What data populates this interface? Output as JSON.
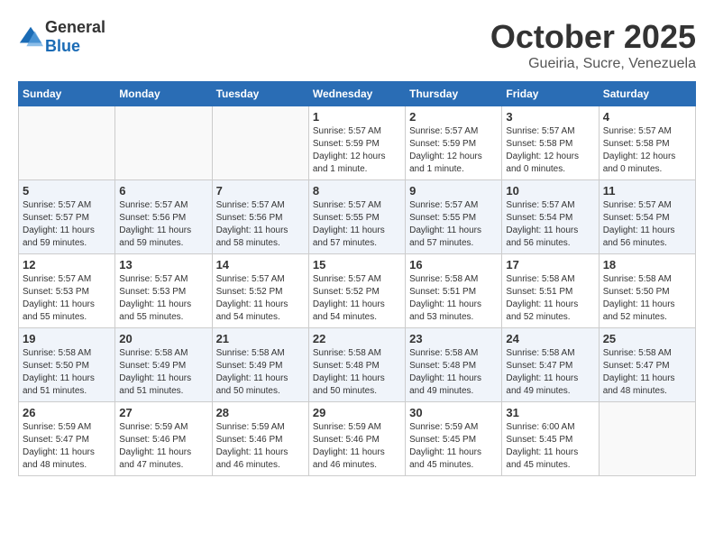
{
  "header": {
    "logo_general": "General",
    "logo_blue": "Blue",
    "month_title": "October 2025",
    "subtitle": "Gueiria, Sucre, Venezuela"
  },
  "days_of_week": [
    "Sunday",
    "Monday",
    "Tuesday",
    "Wednesday",
    "Thursday",
    "Friday",
    "Saturday"
  ],
  "weeks": [
    {
      "shaded": false,
      "days": [
        {
          "number": "",
          "info": ""
        },
        {
          "number": "",
          "info": ""
        },
        {
          "number": "",
          "info": ""
        },
        {
          "number": "1",
          "info": "Sunrise: 5:57 AM\nSunset: 5:59 PM\nDaylight: 12 hours\nand 1 minute."
        },
        {
          "number": "2",
          "info": "Sunrise: 5:57 AM\nSunset: 5:59 PM\nDaylight: 12 hours\nand 1 minute."
        },
        {
          "number": "3",
          "info": "Sunrise: 5:57 AM\nSunset: 5:58 PM\nDaylight: 12 hours\nand 0 minutes."
        },
        {
          "number": "4",
          "info": "Sunrise: 5:57 AM\nSunset: 5:58 PM\nDaylight: 12 hours\nand 0 minutes."
        }
      ]
    },
    {
      "shaded": true,
      "days": [
        {
          "number": "5",
          "info": "Sunrise: 5:57 AM\nSunset: 5:57 PM\nDaylight: 11 hours\nand 59 minutes."
        },
        {
          "number": "6",
          "info": "Sunrise: 5:57 AM\nSunset: 5:56 PM\nDaylight: 11 hours\nand 59 minutes."
        },
        {
          "number": "7",
          "info": "Sunrise: 5:57 AM\nSunset: 5:56 PM\nDaylight: 11 hours\nand 58 minutes."
        },
        {
          "number": "8",
          "info": "Sunrise: 5:57 AM\nSunset: 5:55 PM\nDaylight: 11 hours\nand 57 minutes."
        },
        {
          "number": "9",
          "info": "Sunrise: 5:57 AM\nSunset: 5:55 PM\nDaylight: 11 hours\nand 57 minutes."
        },
        {
          "number": "10",
          "info": "Sunrise: 5:57 AM\nSunset: 5:54 PM\nDaylight: 11 hours\nand 56 minutes."
        },
        {
          "number": "11",
          "info": "Sunrise: 5:57 AM\nSunset: 5:54 PM\nDaylight: 11 hours\nand 56 minutes."
        }
      ]
    },
    {
      "shaded": false,
      "days": [
        {
          "number": "12",
          "info": "Sunrise: 5:57 AM\nSunset: 5:53 PM\nDaylight: 11 hours\nand 55 minutes."
        },
        {
          "number": "13",
          "info": "Sunrise: 5:57 AM\nSunset: 5:53 PM\nDaylight: 11 hours\nand 55 minutes."
        },
        {
          "number": "14",
          "info": "Sunrise: 5:57 AM\nSunset: 5:52 PM\nDaylight: 11 hours\nand 54 minutes."
        },
        {
          "number": "15",
          "info": "Sunrise: 5:57 AM\nSunset: 5:52 PM\nDaylight: 11 hours\nand 54 minutes."
        },
        {
          "number": "16",
          "info": "Sunrise: 5:58 AM\nSunset: 5:51 PM\nDaylight: 11 hours\nand 53 minutes."
        },
        {
          "number": "17",
          "info": "Sunrise: 5:58 AM\nSunset: 5:51 PM\nDaylight: 11 hours\nand 52 minutes."
        },
        {
          "number": "18",
          "info": "Sunrise: 5:58 AM\nSunset: 5:50 PM\nDaylight: 11 hours\nand 52 minutes."
        }
      ]
    },
    {
      "shaded": true,
      "days": [
        {
          "number": "19",
          "info": "Sunrise: 5:58 AM\nSunset: 5:50 PM\nDaylight: 11 hours\nand 51 minutes."
        },
        {
          "number": "20",
          "info": "Sunrise: 5:58 AM\nSunset: 5:49 PM\nDaylight: 11 hours\nand 51 minutes."
        },
        {
          "number": "21",
          "info": "Sunrise: 5:58 AM\nSunset: 5:49 PM\nDaylight: 11 hours\nand 50 minutes."
        },
        {
          "number": "22",
          "info": "Sunrise: 5:58 AM\nSunset: 5:48 PM\nDaylight: 11 hours\nand 50 minutes."
        },
        {
          "number": "23",
          "info": "Sunrise: 5:58 AM\nSunset: 5:48 PM\nDaylight: 11 hours\nand 49 minutes."
        },
        {
          "number": "24",
          "info": "Sunrise: 5:58 AM\nSunset: 5:47 PM\nDaylight: 11 hours\nand 49 minutes."
        },
        {
          "number": "25",
          "info": "Sunrise: 5:58 AM\nSunset: 5:47 PM\nDaylight: 11 hours\nand 48 minutes."
        }
      ]
    },
    {
      "shaded": false,
      "days": [
        {
          "number": "26",
          "info": "Sunrise: 5:59 AM\nSunset: 5:47 PM\nDaylight: 11 hours\nand 48 minutes."
        },
        {
          "number": "27",
          "info": "Sunrise: 5:59 AM\nSunset: 5:46 PM\nDaylight: 11 hours\nand 47 minutes."
        },
        {
          "number": "28",
          "info": "Sunrise: 5:59 AM\nSunset: 5:46 PM\nDaylight: 11 hours\nand 46 minutes."
        },
        {
          "number": "29",
          "info": "Sunrise: 5:59 AM\nSunset: 5:46 PM\nDaylight: 11 hours\nand 46 minutes."
        },
        {
          "number": "30",
          "info": "Sunrise: 5:59 AM\nSunset: 5:45 PM\nDaylight: 11 hours\nand 45 minutes."
        },
        {
          "number": "31",
          "info": "Sunrise: 6:00 AM\nSunset: 5:45 PM\nDaylight: 11 hours\nand 45 minutes."
        },
        {
          "number": "",
          "info": ""
        }
      ]
    }
  ]
}
